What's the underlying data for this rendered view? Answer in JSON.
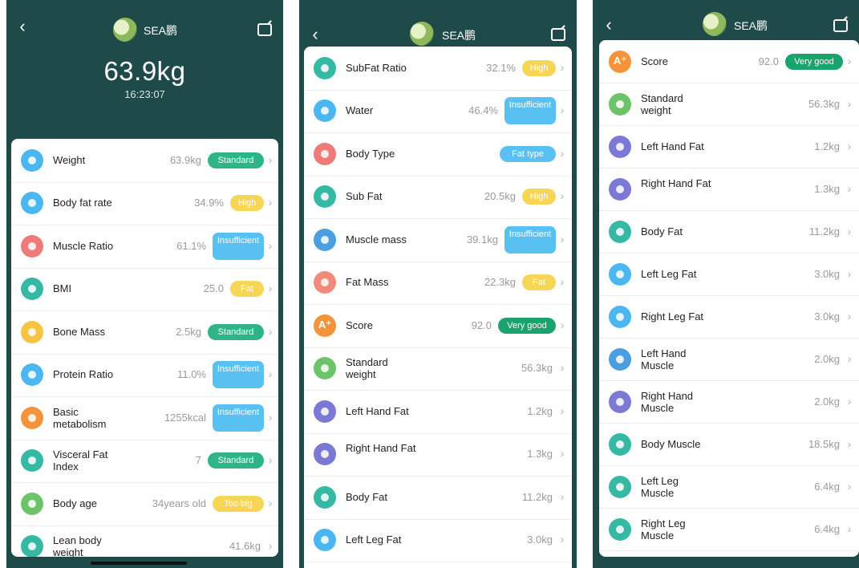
{
  "colors": {
    "header_bg": "#1f4a4a",
    "standard": "#2eb487",
    "high": "#f7d557",
    "insufficient": "#59c1f2",
    "fat": "#f7d557",
    "fat_type": "#59c1f2",
    "very_good": "#1aa36c",
    "too_big": "#f7d557"
  },
  "header": {
    "back_icon": "chevron-left",
    "user_name": "SEA鹏",
    "share_icon": "share-icon"
  },
  "screen1": {
    "weight": "63.9kg",
    "time": "16:23:07",
    "rows": [
      {
        "label": "Weight",
        "value": "63.9kg",
        "badge": "Standard",
        "badge_type": "standard",
        "icon_color": "#4bb7f0",
        "icon": "scale-icon"
      },
      {
        "label": "Body fat rate",
        "value": "34.9%",
        "badge": "High",
        "badge_type": "high",
        "icon_color": "#4bb7f0",
        "icon": "body-fat-icon"
      },
      {
        "label": "Muscle Ratio",
        "value": "61.1%",
        "badge": "Insufficient",
        "badge_type": "insufficient",
        "icon_color": "#ef7a7a",
        "icon": "muscle-icon"
      },
      {
        "label": "BMI",
        "value": "25.0",
        "badge": "Fat",
        "badge_type": "fat",
        "icon_color": "#35b9a5",
        "icon": "bmi-icon"
      },
      {
        "label": "Bone Mass",
        "value": "2.5kg",
        "badge": "Standard",
        "badge_type": "standard",
        "icon_color": "#f6c343",
        "icon": "bone-icon"
      },
      {
        "label": "Protein Ratio",
        "value": "11.0%",
        "badge": "Insufficient",
        "badge_type": "insufficient",
        "icon_color": "#4bb7f0",
        "icon": "protein-icon"
      },
      {
        "label": "Basic metabolism",
        "value": "1255kcal",
        "badge": "Insufficient",
        "badge_type": "insufficient",
        "icon_color": "#f5933b",
        "icon": "flame-icon"
      },
      {
        "label": "Visceral Fat Index",
        "value": "7",
        "badge": "Standard",
        "badge_type": "standard",
        "icon_color": "#35b9a5",
        "icon": "lungs-icon"
      },
      {
        "label": "Body age",
        "value": "34years old",
        "badge": "Too big",
        "badge_type": "too_big",
        "icon_color": "#6cc36a",
        "icon": "age-icon"
      },
      {
        "label": "Lean body weight",
        "value": "41.6kg",
        "badge": "",
        "badge_type": "",
        "icon_color": "#35b9a5",
        "icon": "lean-body-icon"
      }
    ]
  },
  "screen2": {
    "rows": [
      {
        "label": "SubFat Ratio",
        "value": "32.1%",
        "badge": "High",
        "badge_type": "high",
        "icon_color": "#35b9a5",
        "icon": "subfat-ratio-icon"
      },
      {
        "label": "Water",
        "value": "46.4%",
        "badge": "Insufficient",
        "badge_type": "insufficient",
        "icon_color": "#4bb7f0",
        "icon": "water-icon"
      },
      {
        "label": "Body Type",
        "value": "",
        "badge": "Fat type",
        "badge_type": "fat_type",
        "icon_color": "#ef7a7a",
        "icon": "body-type-icon"
      },
      {
        "label": "Sub Fat",
        "value": "20.5kg",
        "badge": "High",
        "badge_type": "high",
        "icon_color": "#35b9a5",
        "icon": "sub-fat-icon"
      },
      {
        "label": "Muscle mass",
        "value": "39.1kg",
        "badge": "Insufficient",
        "badge_type": "insufficient",
        "icon_color": "#4b9fe0",
        "icon": "muscle-mass-icon"
      },
      {
        "label": "Fat Mass",
        "value": "22.3kg",
        "badge": "Fat",
        "badge_type": "fat",
        "icon_color": "#f08a7a",
        "icon": "fat-mass-icon"
      },
      {
        "label": "Score",
        "value": "92.0",
        "badge": "Very good",
        "badge_type": "very_good",
        "icon_color": "#f5933b",
        "icon": "score-icon"
      },
      {
        "label": "Standard weight",
        "value": "56.3kg",
        "badge": "",
        "badge_type": "",
        "icon_color": "#6cc36a",
        "icon": "standard-weight-icon"
      },
      {
        "label": "Left Hand Fat",
        "value": "1.2kg",
        "badge": "",
        "badge_type": "",
        "icon_color": "#7c79d6",
        "icon": "left-hand-fat-icon"
      },
      {
        "label": "Right Hand Fat",
        "value": "1.3kg",
        "badge": "",
        "badge_type": "",
        "icon_color": "#7c79d6",
        "icon": "right-hand-fat-icon"
      },
      {
        "label": "Body Fat",
        "value": "11.2kg",
        "badge": "",
        "badge_type": "",
        "icon_color": "#35b9a5",
        "icon": "body-fat-icon"
      },
      {
        "label": "Left Leg Fat",
        "value": "3.0kg",
        "badge": "",
        "badge_type": "",
        "icon_color": "#4bb7f0",
        "icon": "left-leg-fat-icon"
      }
    ]
  },
  "screen3": {
    "rows": [
      {
        "label": "Score",
        "value": "92.0",
        "badge": "Very good",
        "badge_type": "very_good",
        "icon_color": "#f5933b",
        "icon": "score-icon"
      },
      {
        "label": "Standard weight",
        "value": "56.3kg",
        "badge": "",
        "badge_type": "",
        "icon_color": "#6cc36a",
        "icon": "standard-weight-icon"
      },
      {
        "label": "Left Hand Fat",
        "value": "1.2kg",
        "badge": "",
        "badge_type": "",
        "icon_color": "#7c79d6",
        "icon": "left-hand-fat-icon"
      },
      {
        "label": "Right Hand Fat",
        "value": "1.3kg",
        "badge": "",
        "badge_type": "",
        "icon_color": "#7c79d6",
        "icon": "right-hand-fat-icon"
      },
      {
        "label": "Body Fat",
        "value": "11.2kg",
        "badge": "",
        "badge_type": "",
        "icon_color": "#35b9a5",
        "icon": "body-fat-icon"
      },
      {
        "label": "Left Leg Fat",
        "value": "3.0kg",
        "badge": "",
        "badge_type": "",
        "icon_color": "#4bb7f0",
        "icon": "left-leg-fat-icon"
      },
      {
        "label": "Right Leg Fat",
        "value": "3.0kg",
        "badge": "",
        "badge_type": "",
        "icon_color": "#4bb7f0",
        "icon": "right-leg-fat-icon"
      },
      {
        "label": "Left Hand Muscle",
        "value": "2.0kg",
        "badge": "",
        "badge_type": "",
        "icon_color": "#4b9fe0",
        "icon": "left-hand-muscle-icon"
      },
      {
        "label": "Right Hand Muscle",
        "value": "2.0kg",
        "badge": "",
        "badge_type": "",
        "icon_color": "#7c79d6",
        "icon": "right-hand-muscle-icon"
      },
      {
        "label": "Body Muscle",
        "value": "18.5kg",
        "badge": "",
        "badge_type": "",
        "icon_color": "#35b9a5",
        "icon": "body-muscle-icon"
      },
      {
        "label": "Left Leg Muscle",
        "value": "6.4kg",
        "badge": "",
        "badge_type": "",
        "icon_color": "#35b9a5",
        "icon": "left-leg-muscle-icon"
      },
      {
        "label": "Right Leg Muscle",
        "value": "6.4kg",
        "badge": "",
        "badge_type": "",
        "icon_color": "#35b9a5",
        "icon": "right-leg-muscle-icon"
      }
    ]
  }
}
